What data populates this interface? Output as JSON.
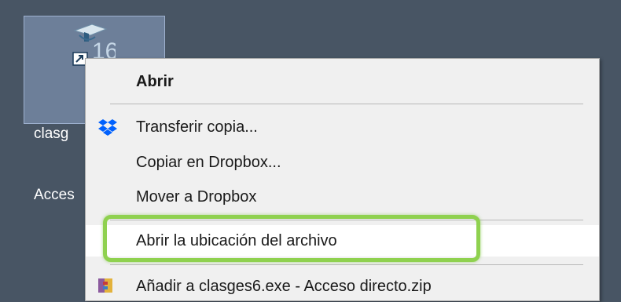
{
  "desktop": {
    "background_color": "#485564",
    "shortcut": {
      "label_line1": "clasg",
      "label_line2": "Acces",
      "icon_badge_text": "16",
      "icon": "clasges-app-shortcut-icon"
    }
  },
  "context_menu": {
    "items": [
      {
        "label": "Abrir",
        "bold": true
      },
      {
        "label": "Transferir copia...",
        "icon": "dropbox-icon"
      },
      {
        "label": "Copiar en Dropbox..."
      },
      {
        "label": "Mover a Dropbox"
      },
      {
        "label": "Abrir la ubicación del archivo",
        "hovered": true
      },
      {
        "label": "Añadir a clasges6.exe - Acceso directo.zip",
        "icon": "zip-archive-icon"
      }
    ],
    "highlight_color": "#8fd14f"
  }
}
